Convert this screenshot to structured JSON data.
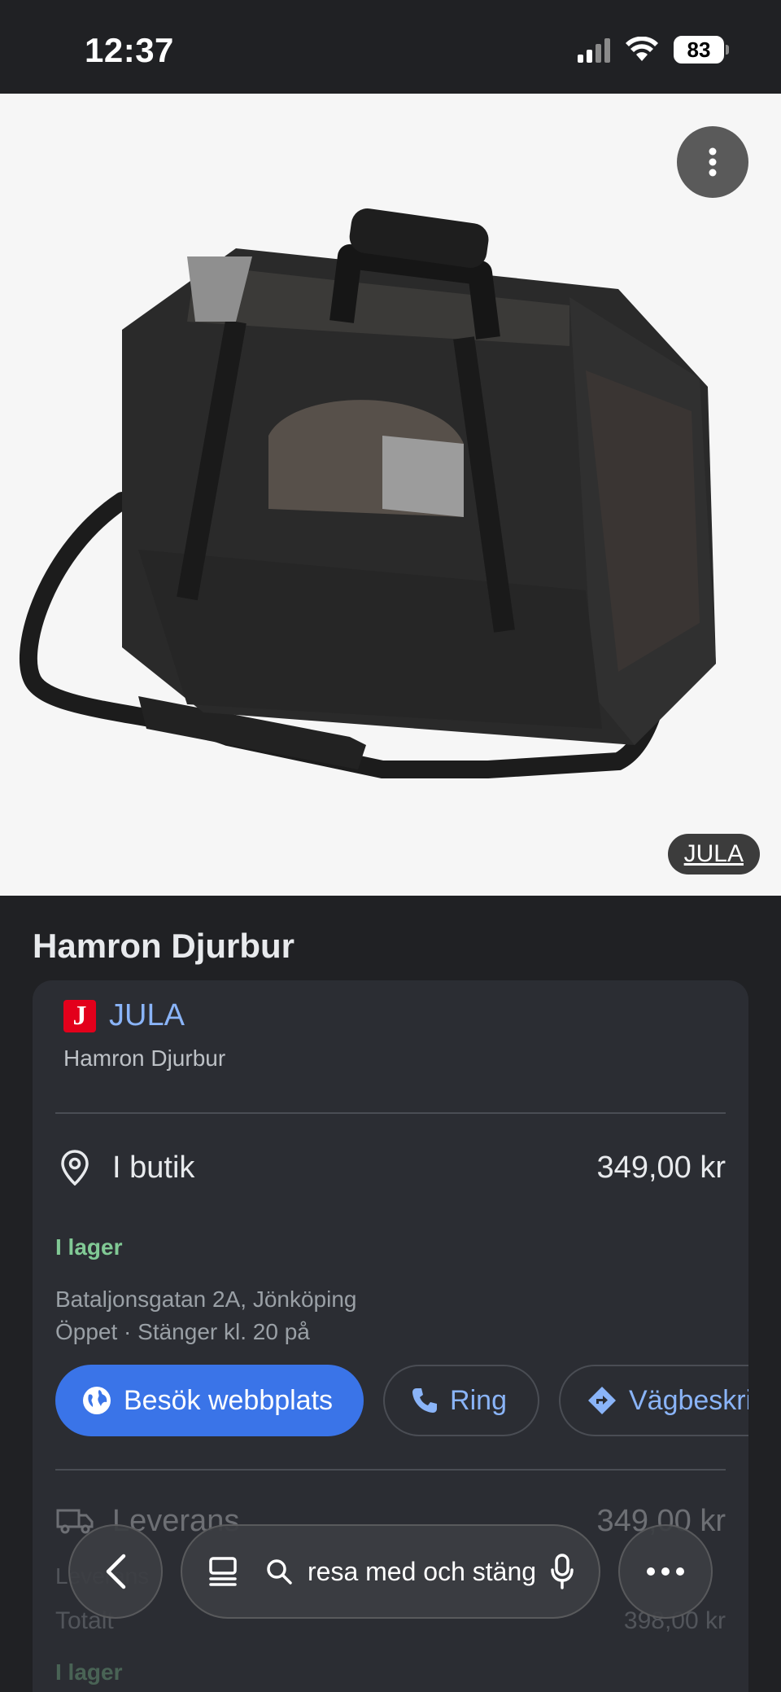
{
  "status": {
    "time": "12:37",
    "battery": "83"
  },
  "hero": {
    "source_chip": "JULA"
  },
  "product": {
    "title": "Hamron Djurbur"
  },
  "merchant": {
    "logo_letter": "J",
    "name": "JULA",
    "product_name": "Hamron Djurbur"
  },
  "in_store": {
    "label": "I butik",
    "price": "349,00 kr",
    "stock": "I lager",
    "address": "Bataljonsgatan 2A, Jönköping",
    "hours": "Öppet · Stänger kl. 20 på"
  },
  "actions": {
    "website": "Besök webbplats",
    "call": "Ring",
    "directions": "Vägbeskrivning"
  },
  "delivery": {
    "label": "Leverans",
    "price": "349,00 kr",
    "delivery_cost_label": "Leverans",
    "total_label": "Totalt",
    "total_price": "398,00 kr",
    "stock": "I lager"
  },
  "bottom_bar": {
    "search_text": "resa med och stänga"
  },
  "colors": {
    "background": "#202124",
    "card": "#2b2d33",
    "link": "#8ab4f8",
    "primary_button": "#3a74e8",
    "in_stock": "#81c995"
  }
}
